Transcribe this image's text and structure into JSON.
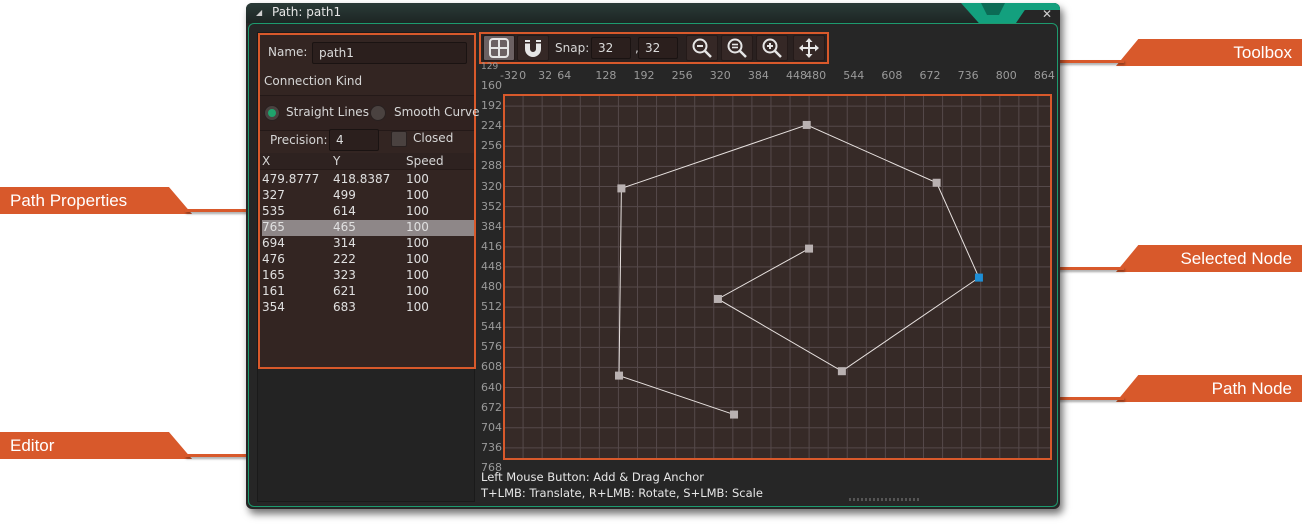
{
  "window": {
    "title": "Path: path1",
    "close_icon": "close-icon"
  },
  "properties": {
    "name_label": "Name:",
    "name_value": "path1",
    "connection_kind_label": "Connection Kind",
    "connection_options": [
      {
        "label": "Straight Lines",
        "selected": true
      },
      {
        "label": "Smooth Curve",
        "selected": false
      }
    ],
    "precision_label": "Precision:",
    "precision_value": "4",
    "closed_label": "Closed",
    "closed_checked": false,
    "columns": [
      "X",
      "Y",
      "Speed"
    ],
    "rows": [
      {
        "x": "479.8777",
        "y": "418.8387",
        "speed": "100",
        "selected": false
      },
      {
        "x": "327",
        "y": "499",
        "speed": "100",
        "selected": false
      },
      {
        "x": "535",
        "y": "614",
        "speed": "100",
        "selected": false
      },
      {
        "x": "765",
        "y": "465",
        "speed": "100",
        "selected": true
      },
      {
        "x": "694",
        "y": "314",
        "speed": "100",
        "selected": false
      },
      {
        "x": "476",
        "y": "222",
        "speed": "100",
        "selected": false
      },
      {
        "x": "165",
        "y": "323",
        "speed": "100",
        "selected": false
      },
      {
        "x": "161",
        "y": "621",
        "speed": "100",
        "selected": false
      },
      {
        "x": "354",
        "y": "683",
        "speed": "100",
        "selected": false
      }
    ]
  },
  "toolbar": {
    "grid_icon": "grid-toggle-icon",
    "snap_icon": "magnet-icon",
    "snap_label": "Snap:",
    "snap_x": "32",
    "snap_separator": ",",
    "snap_y": "32",
    "zoom_out_icon": "zoom-out-icon",
    "zoom_reset_icon": "zoom-reset-icon",
    "zoom_in_icon": "zoom-in-icon",
    "pan_icon": "move-icon"
  },
  "rulers": {
    "top_corner_label": "129",
    "x_ticks": [
      "-32",
      "0",
      "32",
      "64",
      "128",
      "192",
      "256",
      "320",
      "384",
      "448",
      "480",
      "544",
      "608",
      "672",
      "736",
      "800",
      "864"
    ],
    "y_ticks": [
      "160",
      "192",
      "224",
      "256",
      "288",
      "320",
      "352",
      "384",
      "416",
      "448",
      "480",
      "512",
      "544",
      "576",
      "608",
      "640",
      "672",
      "704",
      "736",
      "768"
    ]
  },
  "canvas": {
    "view_x_range": [
      -32,
      896
    ],
    "view_y_range": [
      160,
      784
    ],
    "grid_step": 32,
    "selected_node_index": 3,
    "colors": {
      "node": "#b9b1b1",
      "selected_node": "#1e8fd6",
      "path_line": "#e8e2e0",
      "grid_line": "#55494a",
      "background": "#362a27"
    }
  },
  "help": {
    "line1": "Left Mouse Button: Add & Drag Anchor",
    "line2": "T+LMB: Translate, R+LMB: Rotate, S+LMB: Scale"
  },
  "annotations": {
    "path_properties": "Path Properties",
    "editor": "Editor",
    "toolbox": "Toolbox",
    "selected_node": "Selected Node",
    "path_node": "Path Node",
    "accent_color": "#d8592b"
  }
}
